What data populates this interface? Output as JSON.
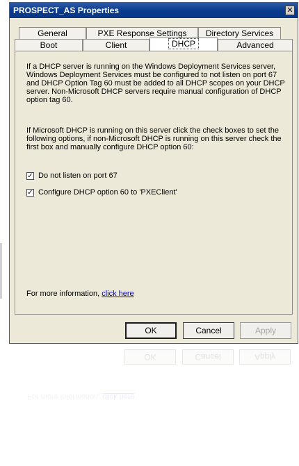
{
  "window": {
    "title": "PROSPECT_AS Properties",
    "close_glyph": "✕"
  },
  "tabs": {
    "row_back": [
      "General",
      "PXE Response Settings",
      "Directory Services"
    ],
    "row_front": [
      "Boot",
      "Client",
      "DHCP",
      "Advanced"
    ],
    "active": "DHCP"
  },
  "content": {
    "paragraph1": "If a DHCP server is running on the Windows Deployment Services server, Windows Deployment Services must be configured to not listen on port 67 and DHCP Option Tag 60 must be added to all DHCP scopes on your DHCP server. Non-Microsoft DHCP servers require manual configuration of DHCP option tag 60.",
    "paragraph2": "If Microsoft DHCP is running on this server click the check boxes to set the following options, if non-Microsoft DHCP is running on this server check the first box and manually configure DHCP option 60:",
    "checkboxes": [
      {
        "label": "Do not listen on port 67",
        "checked": true
      },
      {
        "label": "Configure DHCP option 60 to 'PXEClient'",
        "checked": true
      }
    ],
    "more_info_prefix": "For more information, ",
    "more_info_link": "click here",
    "check_glyph": "✓"
  },
  "buttons": {
    "ok": "OK",
    "cancel": "Cancel",
    "apply": "Apply"
  },
  "colors": {
    "title_bar": "#0a3685",
    "dialog_bg": "#ece9d8",
    "link": "#0000cc",
    "disabled_text": "#a7a7a7"
  }
}
